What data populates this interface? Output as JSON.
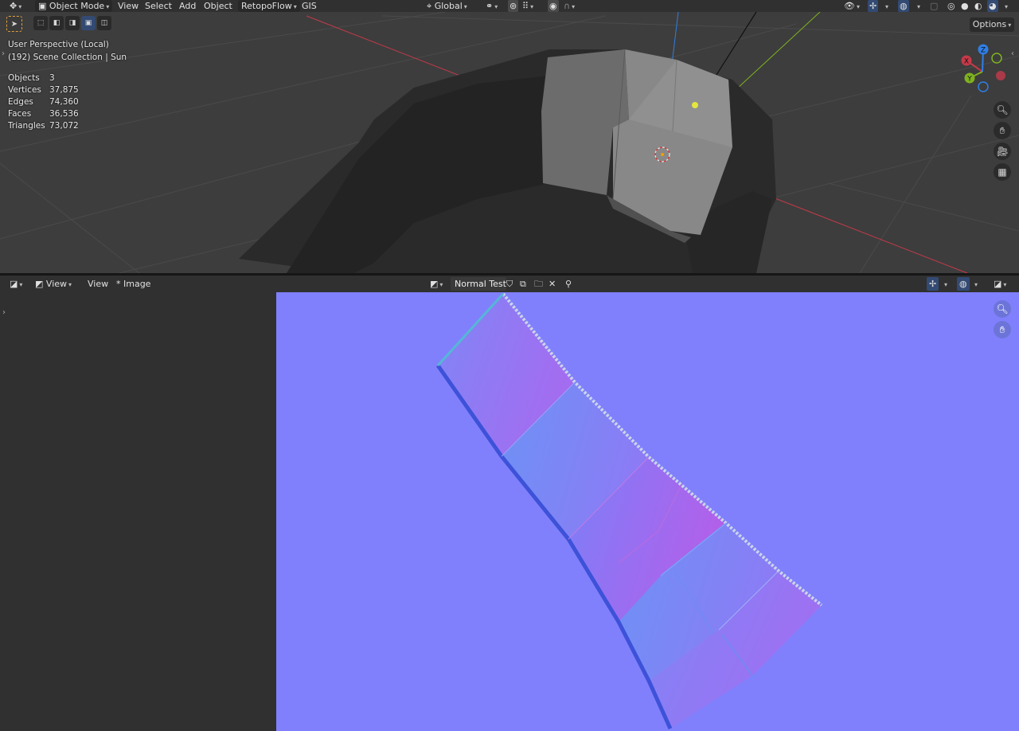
{
  "viewport3d": {
    "header": {
      "mode_label": "Object Mode",
      "menus": [
        "View",
        "Select",
        "Add",
        "Object"
      ],
      "addons": [
        "RetopoFlow",
        "GIS"
      ],
      "orientation_label": "Global"
    },
    "overlay_title": "User Perspective (Local)",
    "overlay_subtitle": "(192) Scene Collection | Sun",
    "stats": [
      {
        "label": "Objects",
        "value": "3"
      },
      {
        "label": "Vertices",
        "value": "37,875"
      },
      {
        "label": "Edges",
        "value": "74,360"
      },
      {
        "label": "Faces",
        "value": "36,536"
      },
      {
        "label": "Triangles",
        "value": "73,072"
      }
    ],
    "options_label": "Options",
    "gizmo": {
      "x": "X",
      "y": "Y",
      "z": "Z"
    },
    "colors": {
      "x_axis": "#c53a4a",
      "y_axis": "#7fb21f",
      "z_axis": "#2f7fe6",
      "background": "#3d3d3d"
    }
  },
  "image_editor": {
    "header": {
      "view_mode_label": "View",
      "menu_view": "View",
      "menu_image": "* Image",
      "image_name": "Normal Test"
    },
    "colors": {
      "normal_flat": "#8080fd",
      "panel": "#303030"
    }
  }
}
